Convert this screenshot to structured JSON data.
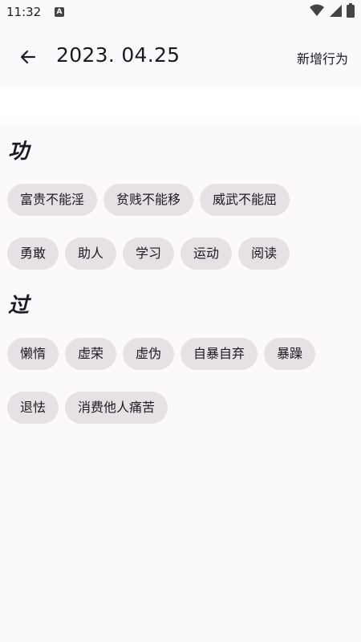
{
  "status_bar": {
    "time": "11:32",
    "notification_icon": "a-icon",
    "icons": [
      "wifi-icon",
      "signal-icon",
      "battery-icon"
    ]
  },
  "app_bar": {
    "back_icon": "arrow-left-icon",
    "title": "2023. 04.25",
    "action_label": "新增行为"
  },
  "sections": [
    {
      "title": "功",
      "rows": [
        [
          "富贵不能淫",
          "贫贱不能移",
          "威武不能屈"
        ],
        [
          "勇敢",
          "助人",
          "学习",
          "运动",
          "阅读"
        ]
      ]
    },
    {
      "title": "过",
      "rows": [
        [
          "懒惰",
          "虚荣",
          "虚伪",
          "自暴自弃",
          "暴躁"
        ],
        [
          "退怯",
          "消费他人痛苦"
        ]
      ]
    }
  ],
  "colors": {
    "background": "#fcf9fc",
    "chip": "#e6e1e5",
    "text": "#1d1b20"
  }
}
